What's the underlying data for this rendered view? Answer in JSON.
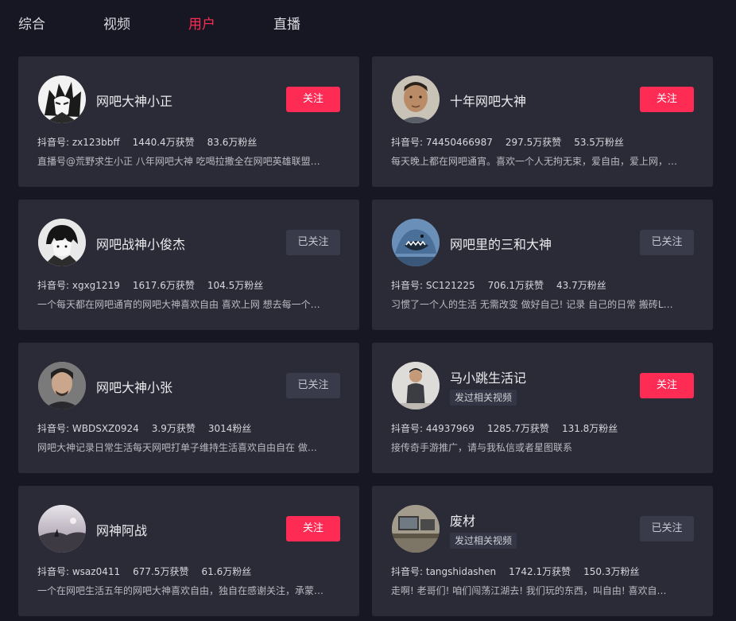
{
  "tabs": [
    {
      "label": "综合",
      "active": false
    },
    {
      "label": "视频",
      "active": false
    },
    {
      "label": "用户",
      "active": true
    },
    {
      "label": "直播",
      "active": false
    }
  ],
  "colors": {
    "accent": "#fe2c55",
    "background": "#161722",
    "card": "#2a2b36"
  },
  "users": [
    {
      "name": "网吧大神小正",
      "avatar_icon": "anime-avatar-icon",
      "button": "关注",
      "followed": false,
      "douyin_id": "抖音号: zx123bbff",
      "likes": "1440.4万获赞",
      "fans": "83.6万粉丝",
      "desc": "直播号@荒野求生小正 八年网吧大神 吃喝拉撒全在网吧英雄联盟…"
    },
    {
      "name": "十年网吧大神",
      "avatar_icon": "man-face-avatar-icon",
      "button": "关注",
      "followed": false,
      "douyin_id": "抖音号: 74450466987",
      "likes": "297.5万获赞",
      "fans": "53.5万粉丝",
      "desc": "每天晚上都在网吧通宵。喜欢一个人无拘无束，爱自由，爱上网，…"
    },
    {
      "name": "网吧战神小俊杰",
      "avatar_icon": "anime-boy-avatar-icon",
      "button": "已关注",
      "followed": true,
      "douyin_id": "抖音号: xgxg1219",
      "likes": "1617.6万获赞",
      "fans": "104.5万粉丝",
      "desc": "一个每天都在网吧通宵的网吧大神喜欢自由 喜欢上网 想去每一个…"
    },
    {
      "name": "网吧里的三和大神",
      "avatar_icon": "shark-cartoon-avatar-icon",
      "button": "已关注",
      "followed": true,
      "douyin_id": "抖音号: SC121225",
      "likes": "706.1万获赞",
      "fans": "43.7万粉丝",
      "desc": "习惯了一个人的生活 无需改变 做好自己! 记录 自己的日常 搬砖L…"
    },
    {
      "name": "网吧大神小张",
      "avatar_icon": "man-portrait-avatar-icon",
      "button": "已关注",
      "followed": true,
      "douyin_id": "抖音号: WBDSXZ0924",
      "likes": "3.9万获赞",
      "fans": "3014粉丝",
      "desc": "网吧大神记录日常生活每天网吧打单子维持生活喜欢自由自在 做…"
    },
    {
      "name": "马小跳生活记",
      "tag": "发过相关视频",
      "avatar_icon": "person-standing-avatar-icon",
      "button": "关注",
      "followed": false,
      "douyin_id": "抖音号: 44937969",
      "likes": "1285.7万获赞",
      "fans": "131.8万粉丝",
      "desc": "接传奇手游推广，请与我私信或者星图联系"
    },
    {
      "name": "网神阿战",
      "avatar_icon": "sunset-landscape-avatar-icon",
      "button": "关注",
      "followed": false,
      "douyin_id": "抖音号: wsaz0411",
      "likes": "677.5万获赞",
      "fans": "61.6万粉丝",
      "desc": "一个在网吧生活五年的网吧大神喜欢自由，独自在感谢关注，承蒙…"
    },
    {
      "name": "废材",
      "tag": "发过相关视频",
      "avatar_icon": "computer-desk-avatar-icon",
      "button": "已关注",
      "followed": true,
      "douyin_id": "抖音号: tangshidashen",
      "likes": "1742.1万获赞",
      "fans": "150.3万粉丝",
      "desc": "走啊! 老哥们! 咱们闯荡江湖去! 我们玩的东西，叫自由! 喜欢自…"
    }
  ]
}
